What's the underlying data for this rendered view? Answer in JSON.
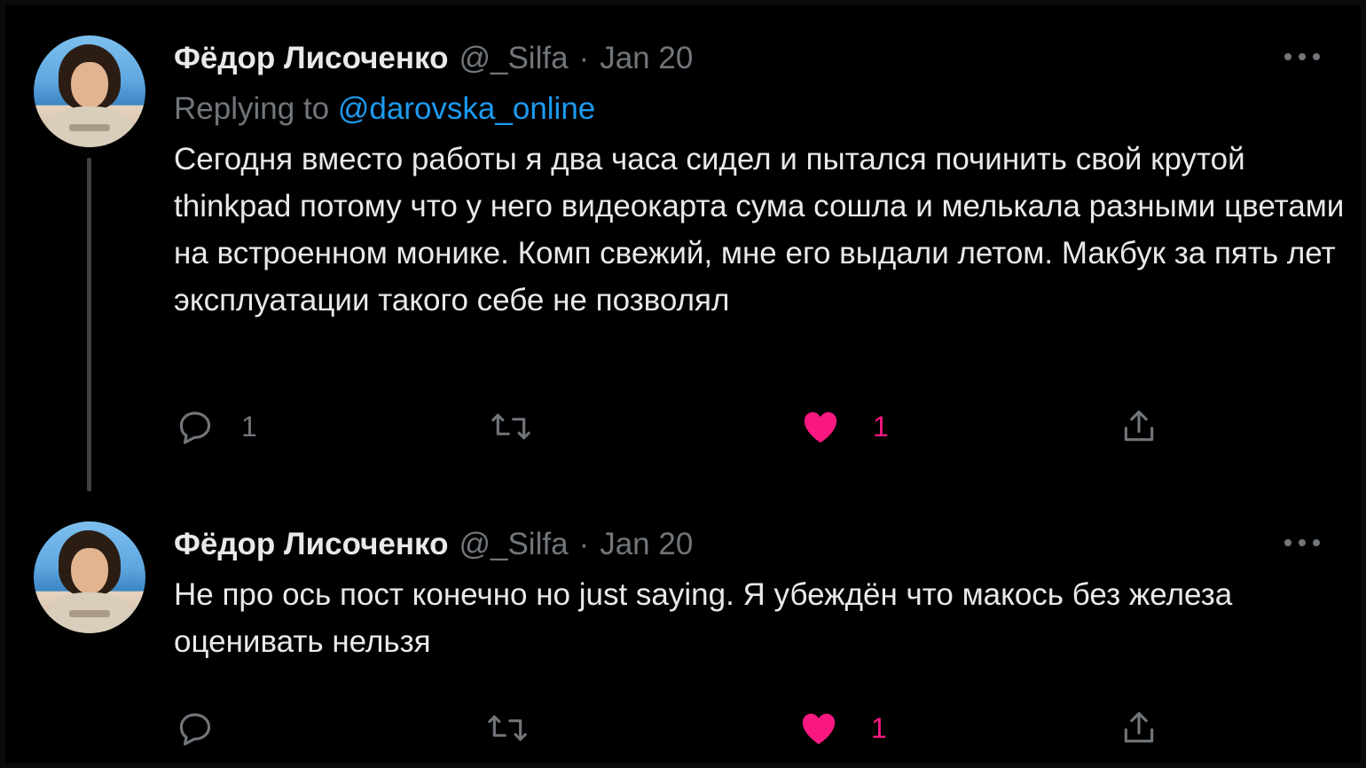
{
  "tweets": [
    {
      "author_name": "Фёдор Лисоченко",
      "handle": "@_Silfa",
      "separator": "·",
      "date": "Jan 20",
      "replying_prefix": "Replying to",
      "replying_to": "@darovska_online",
      "text": "Сегодня вместо работы я два часа сидел и пытался починить свой крутой thinkpad потому что у него видеокарта сума сошла и мелькала разными цветами на встроенном монике. Комп свежий, мне его выдали летом. Макбук за пять лет эксплуатации такого себе не позволял",
      "reply_count": "1",
      "retweet_count": "",
      "like_count": "1",
      "liked": true
    },
    {
      "author_name": "Фёдор Лисоченко",
      "handle": "@_Silfa",
      "separator": "·",
      "date": "Jan 20",
      "text": "Не про ось пост конечно но just saying. Я убеждён что макось без железа оценивать нельзя",
      "reply_count": "",
      "retweet_count": "",
      "like_count": "1",
      "liked": true
    }
  ],
  "icons": {
    "reply": "reply-icon",
    "retweet": "retweet-icon",
    "like": "heart-icon",
    "share": "share-icon",
    "more": "more-icon"
  },
  "colors": {
    "background": "#000000",
    "text": "#e7e9ea",
    "muted": "#71767b",
    "link": "#1d9bf0",
    "like": "#f91880"
  }
}
